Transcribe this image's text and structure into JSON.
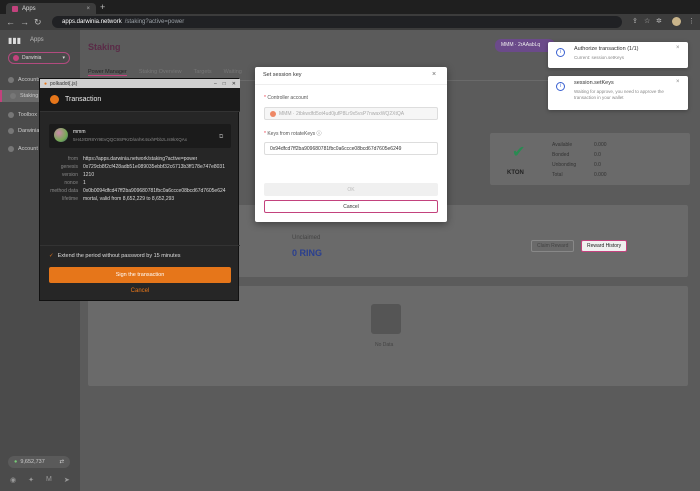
{
  "browser": {
    "tab_title": "Apps",
    "tab_close": "×",
    "new_tab": "+",
    "url_host": "apps.darwinia.network",
    "url_path": "/staking?active=power"
  },
  "sidebar": {
    "logo": "▮▮▮",
    "app_name": "Apps",
    "network": "Darwinia",
    "items": [
      {
        "label": "Accounts"
      },
      {
        "label": "Staking"
      },
      {
        "label": "Toolbox"
      },
      {
        "label": "Darwinia"
      },
      {
        "label": "Account"
      }
    ],
    "block_number": "9,652,737"
  },
  "main": {
    "title": "Staking",
    "account_chip": "MMM · 2rAAabLq",
    "tabs": [
      "Power Manager",
      "Staking Overview",
      "Targets",
      "Waiting"
    ],
    "kton": {
      "label": "KTON",
      "rows": [
        {
          "k": "Available",
          "v": "0.000"
        },
        {
          "k": "Bonded",
          "v": "0.0"
        },
        {
          "k": "Unbonding",
          "v": "0.0"
        },
        {
          "k": "Total",
          "v": "0.000"
        }
      ]
    },
    "unclaimed_label": "Unclaimed",
    "unclaimed_value": "0 RING",
    "claim_reward": "Claim Reward",
    "reward_history": "Reward History",
    "no_data": "No Data"
  },
  "polkadot": {
    "window_title": "polkadot{.js}",
    "header_title": "Transaction",
    "account_name": "mmm",
    "account_address": "5H4JrDR8Yr9EvQQC9SPKrD/anhK4sxhPbbzLrs9kXQAx",
    "rows": [
      {
        "k": "from",
        "v": "https://apps.darwinia.network/staking?active=power"
      },
      {
        "k": "genesis",
        "v": "0x729cb8f2cf428adb51e089035ebbf32c6713b3ff178e747e8031"
      },
      {
        "k": "version",
        "v": "1210"
      },
      {
        "k": "nonce",
        "v": "1"
      },
      {
        "k": "method data",
        "v": "0x0b0094dfcd47ff2ba909680781fbc0a6ccce08bcd67d7605e624"
      },
      {
        "k": "lifetime",
        "v": "mortal, valid from 8,652,229 to 8,652,293"
      }
    ],
    "remember": "Extend the period without password by 15 minutes",
    "sign_button": "Sign the transaction",
    "cancel": "Cancel"
  },
  "modal": {
    "title": "Set session key",
    "controller_label": "Controller account",
    "controller_value": "MMM · 2tbkwdfd5ot4ud0jufP8Lr9x5vsP7nwaxWQ2XtQA",
    "keys_label": "Keys from rotateKeys",
    "keys_value": "0x94dfcd7ff2ba909680781fbc0a6ccce08bcd67d7605e6249",
    "ok": "OK",
    "cancel": "Cancel"
  },
  "notifications": [
    {
      "title": "Authorize transaction (1/1)",
      "sub": "Current: session.setKeys"
    },
    {
      "title": "session.setKeys",
      "sub": "Waiting for approve, you need to approve the transaction in your wallet"
    }
  ]
}
